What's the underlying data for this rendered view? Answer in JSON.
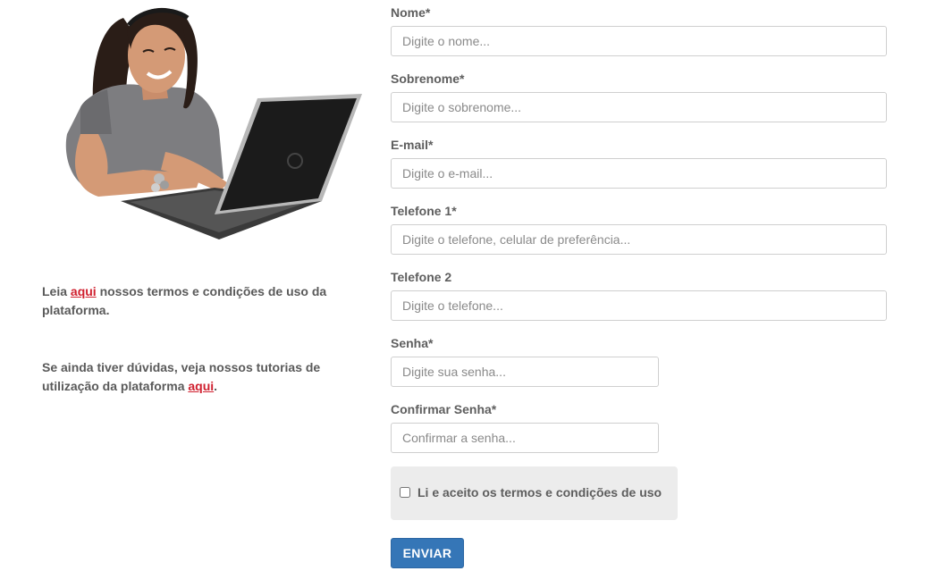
{
  "hero": {
    "image": "girl-with-laptop-illustration"
  },
  "info": {
    "terms_prefix": "Leia ",
    "terms_link": "aqui",
    "terms_suffix": " nossos termos e condições de uso da plataforma.",
    "tutorial_prefix": "Se ainda tiver dúvidas, veja nossos tutorias de utilização da plataforma ",
    "tutorial_link": "aqui",
    "tutorial_suffix": "."
  },
  "form": {
    "nome": {
      "label": "Nome*",
      "placeholder": "Digite o nome...",
      "value": ""
    },
    "sobrenome": {
      "label": "Sobrenome*",
      "placeholder": "Digite o sobrenome...",
      "value": ""
    },
    "email": {
      "label": "E-mail*",
      "placeholder": "Digite o e-mail...",
      "value": ""
    },
    "telefone1": {
      "label": "Telefone 1*",
      "placeholder": "Digite o telefone, celular de preferência...",
      "value": ""
    },
    "telefone2": {
      "label": "Telefone 2",
      "placeholder": "Digite o telefone...",
      "value": ""
    },
    "senha": {
      "label": "Senha*",
      "placeholder": "Digite sua senha...",
      "value": ""
    },
    "confirmar": {
      "label": "Confirmar Senha*",
      "placeholder": "Confirmar a senha...",
      "value": ""
    },
    "agree_label": "Li e aceito os termos e condições de uso",
    "agree_checked": false,
    "submit_label": "ENVIAR"
  },
  "colors": {
    "link": "#d0202f",
    "button": "#3576b7",
    "agree_bg": "#ececec"
  }
}
